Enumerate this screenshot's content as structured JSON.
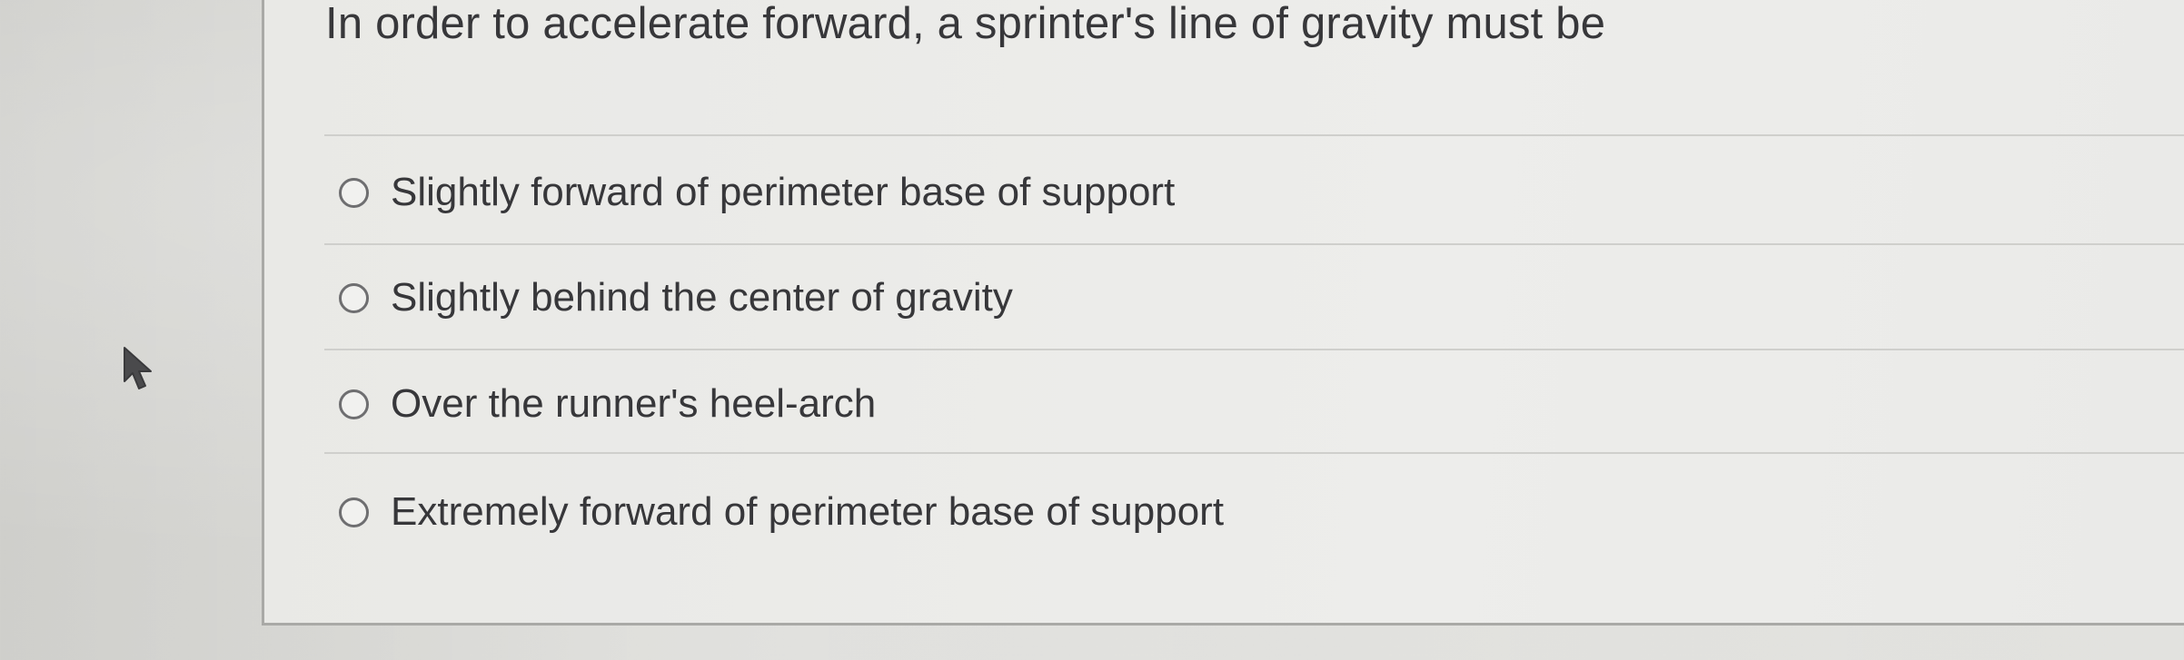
{
  "question": {
    "text": "In order to accelerate forward, a sprinter's line of gravity must be"
  },
  "options": [
    {
      "label": "Slightly forward of perimeter base of support",
      "selected": false
    },
    {
      "label": "Slightly behind the center of gravity",
      "selected": false
    },
    {
      "label": "Over the runner's heel-arch",
      "selected": false
    },
    {
      "label": "Extremely forward of perimeter base of support",
      "selected": false
    }
  ],
  "cursor": {
    "icon": "mouse-pointer-icon",
    "color": "#4a4a4c"
  },
  "colors": {
    "text": "#37373a",
    "radio_border": "#6e6e70",
    "divider": "#cfcfcc",
    "card_border": "#a9a9a6"
  }
}
